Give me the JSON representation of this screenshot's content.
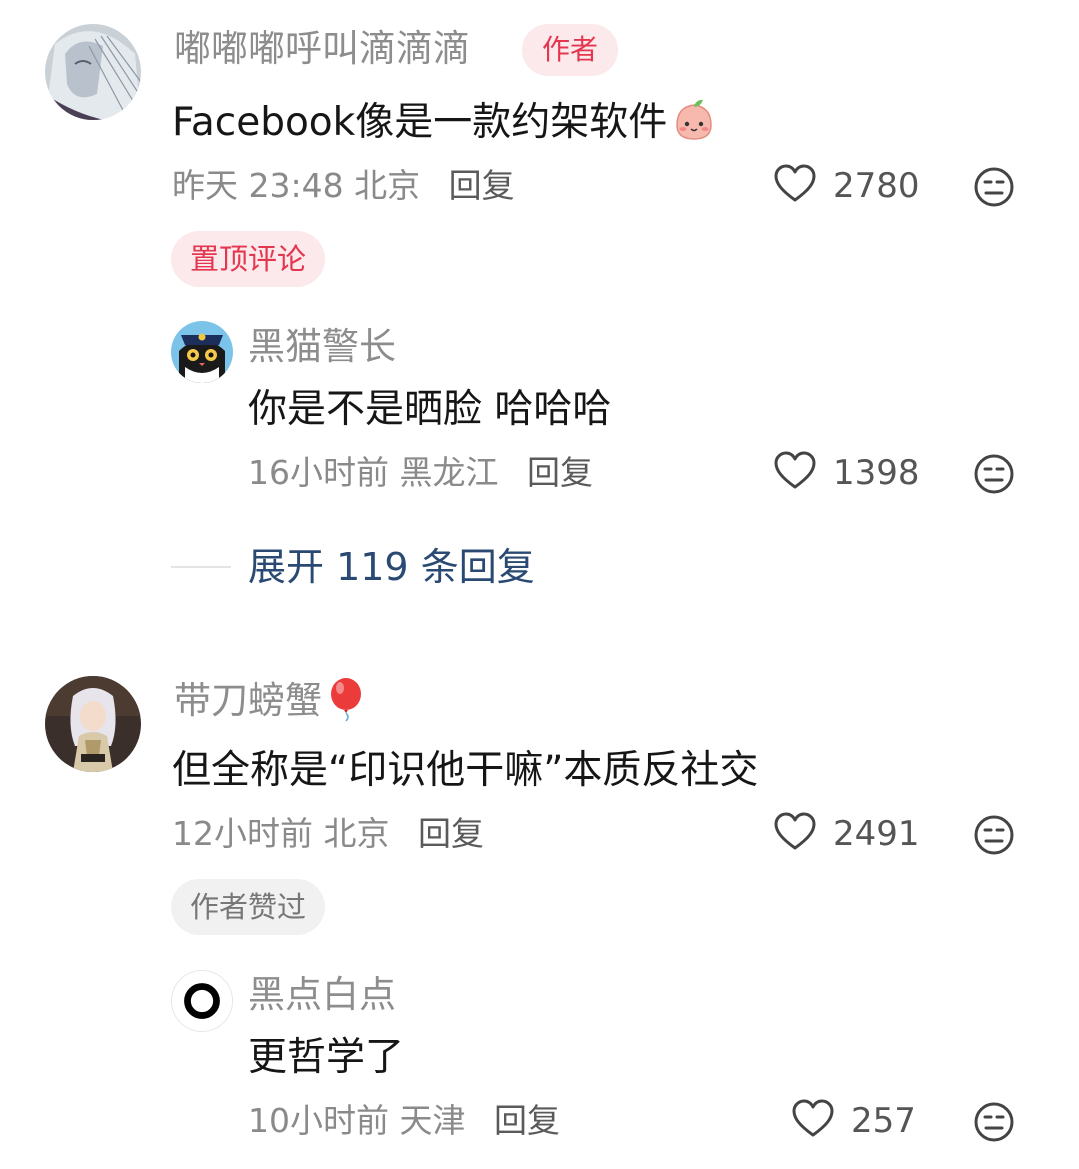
{
  "colors": {
    "name_gray": "#8d8d8d",
    "text_dark": "#161616",
    "badge_red": "#e5364f",
    "badge_bg": "#fbe9ec",
    "expand_blue": "#2a4a73"
  },
  "comments": [
    {
      "username": "嘟嘟嘟呼叫滴滴滴",
      "author_badge": "作者",
      "text": "Facebook像是一款约架软件",
      "emoji_icon": "peach-emoji-icon",
      "time": "昨天 23:48",
      "location": "北京",
      "reply_label": "回复",
      "likes": "2780",
      "pin_badge": "置顶评论",
      "replies": [
        {
          "username": "黑猫警长",
          "text": "你是不是晒脸 哈哈哈",
          "time": "16小时前",
          "location": "黑龙江",
          "reply_label": "回复",
          "likes": "1398"
        }
      ],
      "expand_label": "展开 119 条回复"
    },
    {
      "username": "带刀螃蟹",
      "username_icon": "red-balloon-icon",
      "text": "但全称是“印识他干嘛”本质反社交",
      "time": "12小时前",
      "location": "北京",
      "reply_label": "回复",
      "likes": "2491",
      "liked_badge": "作者赞过",
      "replies": [
        {
          "username": "黑点白点",
          "text": "更哲学了",
          "time": "10小时前",
          "location": "天津",
          "reply_label": "回复",
          "likes": "257"
        }
      ]
    }
  ]
}
